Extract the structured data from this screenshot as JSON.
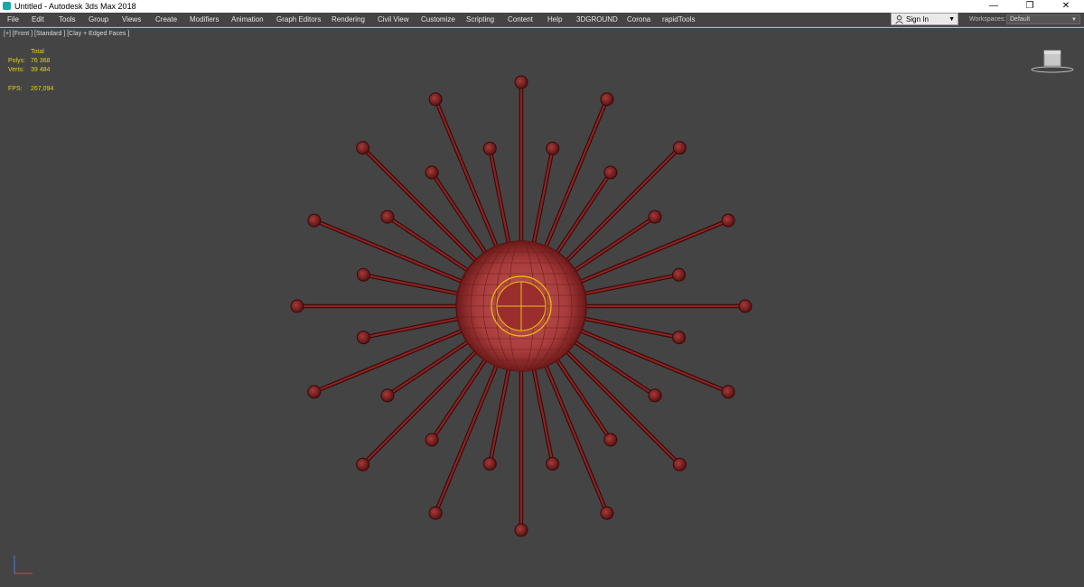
{
  "window": {
    "title": "Untitled - Autodesk 3ds Max 2018",
    "minimize": "—",
    "restore": "❐",
    "close": "✕"
  },
  "menu": [
    "File",
    "Edit",
    "Tools",
    "Group",
    "Views",
    "Create",
    "Modifiers",
    "Animation",
    "Graph Editors",
    "Rendering",
    "Civil View",
    "Customize",
    "Scripting",
    "Content",
    "Help",
    "3DGROUND",
    "Corona",
    "rapidTools"
  ],
  "signin": {
    "label": "Sign In"
  },
  "workspaces": {
    "label": "Workspaces:",
    "value": "Default"
  },
  "viewport": {
    "label": "[+] [Front ] [Standard ] [Clay + Edged Faces ]",
    "stats": {
      "header": "Total",
      "polys_label": "Polys:",
      "polys_value": "76 368",
      "verts_label": "Verts:",
      "verts_value": "39 484",
      "fps_label": "FPS:",
      "fps_value": "267,094"
    }
  },
  "colors": {
    "viewport_bg": "#444444",
    "mesh": "#8b2020",
    "selection_yellow": "#e8c400",
    "stats_text": "#e1d21c"
  }
}
